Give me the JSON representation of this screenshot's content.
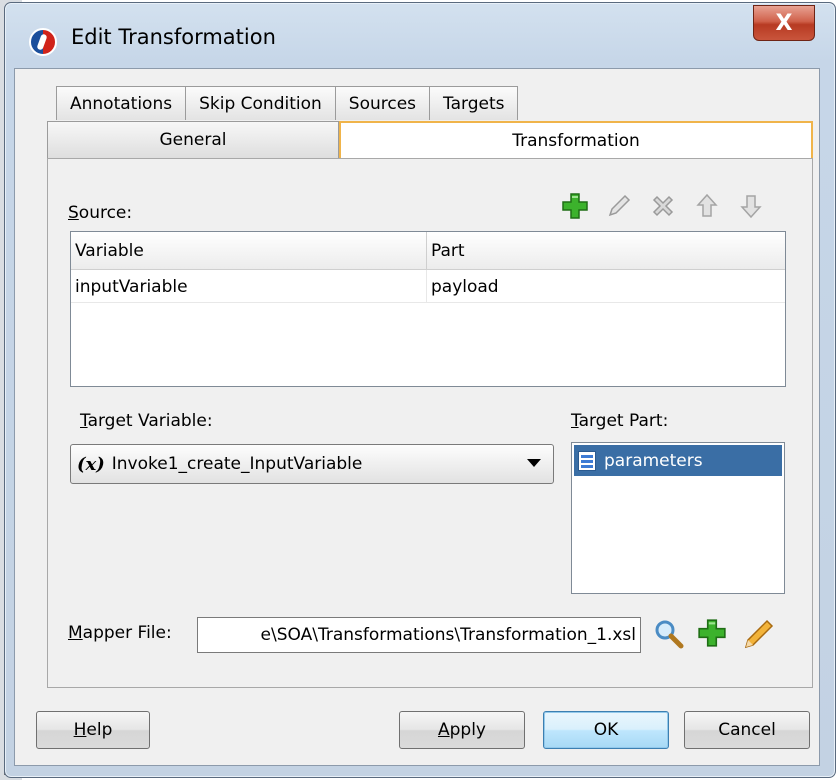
{
  "window": {
    "title": "Edit Transformation",
    "close_label": "X"
  },
  "tabs": {
    "row1": [
      "Annotations",
      "Skip Condition",
      "Sources",
      "Targets"
    ],
    "general": "General",
    "transformation": "Transformation",
    "active": "Transformation"
  },
  "source": {
    "label": "Source:",
    "toolbar_icons": [
      "add-icon",
      "edit-icon",
      "delete-icon",
      "move-up-icon",
      "move-down-icon"
    ],
    "columns": [
      "Variable",
      "Part"
    ],
    "rows": [
      {
        "variable": "inputVariable",
        "part": "payload"
      }
    ]
  },
  "target_variable": {
    "label": "Target Variable:",
    "icon_text": "(x)",
    "value": "Invoke1_create_InputVariable"
  },
  "target_part": {
    "label": "Target Part:",
    "items": [
      "parameters"
    ],
    "selected": "parameters"
  },
  "mapper": {
    "label": "Mapper File:",
    "value": "e\\SOA\\Transformations\\Transformation_1.xsl",
    "icons": [
      "search-icon",
      "add-icon",
      "edit-icon"
    ]
  },
  "buttons": {
    "help": "Help",
    "apply": "Apply",
    "ok": "OK",
    "cancel": "Cancel"
  },
  "colors": {
    "accent_tab_border": "#f0b44a",
    "selection": "#3a6ea5",
    "close_button": "#c9553c"
  }
}
